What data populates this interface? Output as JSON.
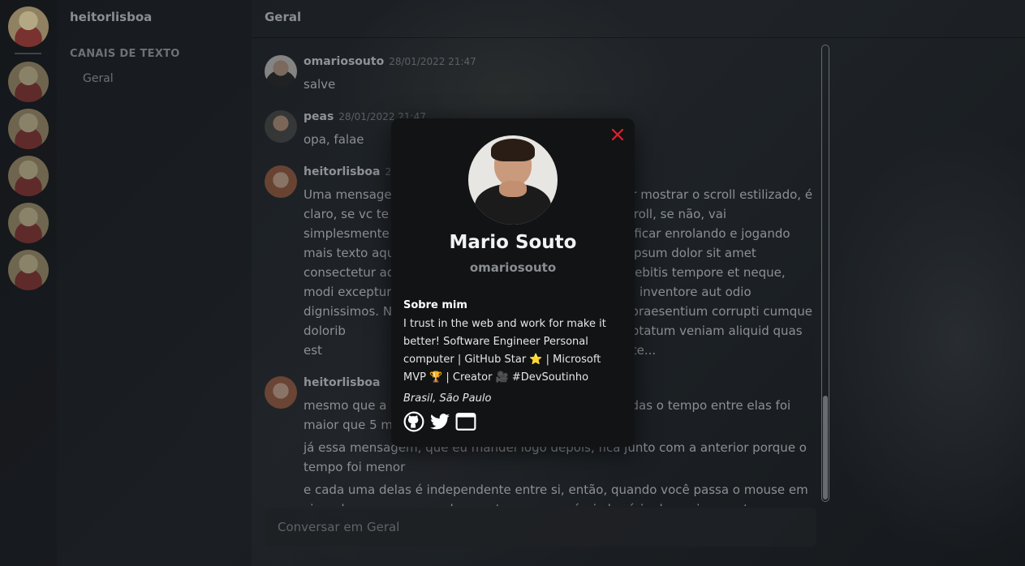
{
  "guild": {
    "name": "heitorlisboa"
  },
  "channels": {
    "category": "CANAIS DE TEXTO",
    "items": [
      {
        "label": "Geral"
      }
    ]
  },
  "chat": {
    "title": "Geral",
    "messages": [
      {
        "author": "omariosouto",
        "time": "28/01/2022 21:47",
        "lines": [
          "salve"
        ]
      },
      {
        "author": "peas",
        "time": "28/01/2022 21:47",
        "lines": [
          "opa, falae"
        ]
      },
      {
        "author": "heitorlisboa",
        "time": "28",
        "lines": [
          "Uma mensagem                                                       der mostrar o scroll estilizado, é claro, se vc te                                                       do scroll, se não, vai simplesmente f                                                       ora ficar enrolando e jogando mais texto aqui                                                       m, ipsum dolor sit amet consectetur adi                                                       et debitis tempore et neque, modi excepturi,                                                       tem inventore aut odio dignissimos. Ni                                                       tus praesentium corrupti cumque dolorib                                                       ostrum voluptatum veniam aliquid quas est                                                       ja texto suficiente..."
        ]
      },
      {
        "author": "heitorlisboa",
        "time": "",
        "lines": [
          "mesmo que a ú                                                       aradas o tempo entre elas foi maior que 5 mi",
          "já essa mensagem, que eu mandei logo depois, fica junto com a anterior porque o tempo foi menor",
          "e cada uma delas é independente entre si, então, quando você passa o mouse em cima da mensagem, cada uma tem o seu próprio horário de envio, exceto a primeira que já"
        ]
      }
    ],
    "composer_placeholder": "Conversar em Geral"
  },
  "profile": {
    "name": "Mario Souto",
    "handle": "omariosouto",
    "about_title": "Sobre mim",
    "about": "I trust in the web and work for make it better! Software Engineer Personal computer | GitHub Star ⭐ | Microsoft MVP 🏆 | Creator 🎥 #DevSoutinho",
    "location": "Brasil, São Paulo",
    "links": [
      "github-icon",
      "twitter-icon",
      "website-icon"
    ],
    "close_color": "#e0212f"
  }
}
